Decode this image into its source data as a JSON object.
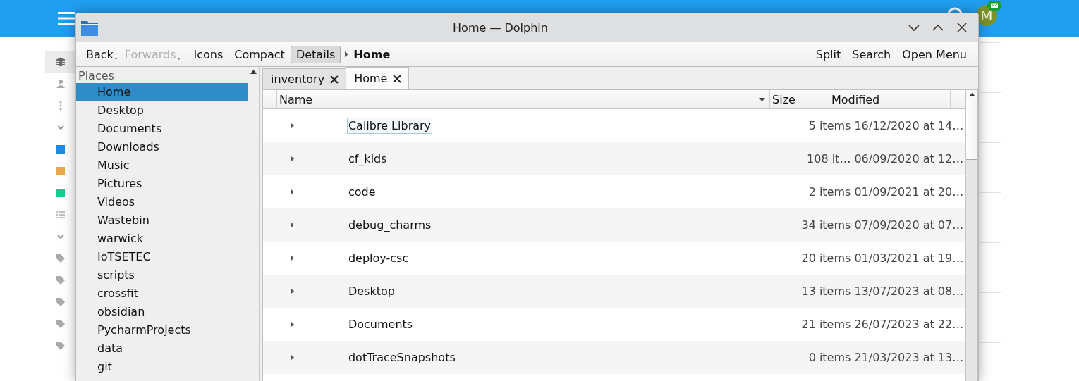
{
  "backdrop": {
    "avatar_letter": "M"
  },
  "window": {
    "title": "Home — Dolphin"
  },
  "toolbar": {
    "navigation": [
      {
        "label": "Back",
        "disabled": false
      },
      {
        "label": "Forwards",
        "disabled": true
      }
    ],
    "view_modes": [
      {
        "label": "Icons",
        "selected": false
      },
      {
        "label": "Compact",
        "selected": false
      },
      {
        "label": "Details",
        "selected": true
      }
    ],
    "breadcrumb": "Home",
    "actions": [
      "Split",
      "Search",
      "Open Menu"
    ]
  },
  "places": {
    "title": "Places",
    "items": [
      {
        "label": "Home",
        "selected": true
      },
      {
        "label": "Desktop",
        "selected": false
      },
      {
        "label": "Documents",
        "selected": false
      },
      {
        "label": "Downloads",
        "selected": false
      },
      {
        "label": "Music",
        "selected": false
      },
      {
        "label": "Pictures",
        "selected": false
      },
      {
        "label": "Videos",
        "selected": false
      },
      {
        "label": "Wastebin",
        "selected": false
      },
      {
        "label": "warwick",
        "selected": false
      },
      {
        "label": "IoTSETEC",
        "selected": false
      },
      {
        "label": "scripts",
        "selected": false
      },
      {
        "label": "crossfit",
        "selected": false
      },
      {
        "label": "obsidian",
        "selected": false
      },
      {
        "label": "PycharmProjects",
        "selected": false
      },
      {
        "label": "data",
        "selected": false
      },
      {
        "label": "git",
        "selected": false
      }
    ]
  },
  "tabs": [
    {
      "label": "inventory",
      "selected": false
    },
    {
      "label": "Home",
      "selected": true
    }
  ],
  "table": {
    "columns": [
      "Name",
      "Size",
      "Modified"
    ],
    "rows": [
      {
        "name": "Calibre Library",
        "size": "5 items",
        "modified": "16/12/2020 at 14…",
        "focused": true
      },
      {
        "name": "cf_kids",
        "size": "108 it…",
        "modified": "06/09/2020 at 12…",
        "focused": false
      },
      {
        "name": "code",
        "size": "2 items",
        "modified": "01/09/2021 at 20…",
        "focused": false
      },
      {
        "name": "debug_charms",
        "size": "34 items",
        "modified": "07/09/2020 at 07…",
        "focused": false
      },
      {
        "name": "deploy-csc",
        "size": "20 items",
        "modified": "01/03/2021 at 19…",
        "focused": false
      },
      {
        "name": "Desktop",
        "size": "13 items",
        "modified": "13/07/2023 at 08…",
        "focused": false
      },
      {
        "name": "Documents",
        "size": "21 items",
        "modified": "26/07/2023 at 22…",
        "focused": false
      },
      {
        "name": "dotTraceSnapshots",
        "size": "0 items",
        "modified": "21/03/2023 at 13…",
        "focused": false
      }
    ]
  }
}
